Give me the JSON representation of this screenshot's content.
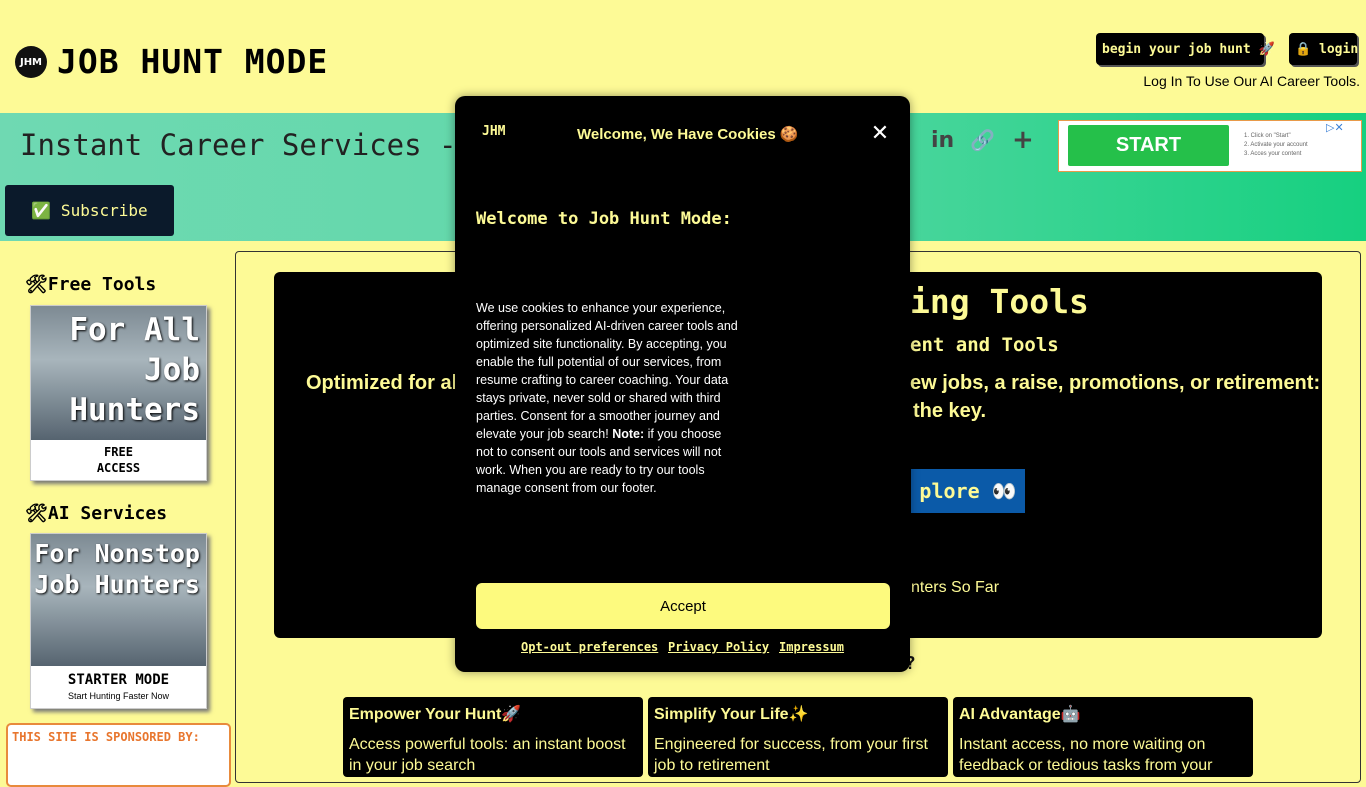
{
  "header": {
    "logo_badge": "JHM",
    "brand_title": "JOB HUNT MODE",
    "begin_hunt_label": "begin your job hunt 🚀",
    "login_label": "🔒 login",
    "login_note": "Log In To Use Our AI Career Tools."
  },
  "banner": {
    "title": "Instant Career Services -",
    "social_icons": [
      "pinterest-icon",
      "linkedin-icon",
      "link-icon",
      "plus-icon"
    ],
    "social_glyphs": [
      "in",
      "🔗",
      "+"
    ],
    "subscribe_label": "✅ Subscribe",
    "ad": {
      "start_label": "START",
      "steps": [
        "1. Click on \"Start\"",
        "2. Activate your account",
        "3. Acces your content"
      ],
      "corner": "▷✕"
    }
  },
  "sidebar": {
    "free_tools_heading": "🛠Free Tools",
    "ai_services_heading": "🛠AI Services",
    "cards": [
      {
        "image_text": "For All Job Hunters",
        "label_line1": "FREE",
        "label_line2": "ACCESS"
      },
      {
        "image_text": "For Nonstop Job Hunters",
        "label_line1": "STARTER MODE",
        "label_line2": "Start Hunting Faster Now"
      }
    ],
    "sponsor_text": "THIS SITE IS SPONSORED BY:"
  },
  "hero": {
    "title_fragment": "ing Tools",
    "subtitle_fragment": "ent and Tools",
    "left_fragment": "Optimized for all",
    "right_line1": "ew jobs, a raise, promotions, or retirement:",
    "right_line2": "the key.",
    "explore_label": "plore 👀",
    "hunters_fragment": "nters So Far"
  },
  "section_question_fragment": "?",
  "features": [
    {
      "title": "Empower Your Hunt🚀",
      "body": "Access powerful tools: an instant boost in your job search"
    },
    {
      "title": "Simplify Your Life✨",
      "body": "Engineered for success, from your first job to retirement"
    },
    {
      "title": "AI Advantage🤖",
      "body": "Instant access, no more waiting on feedback or tedious tasks from your"
    }
  ],
  "modal": {
    "logo": "JHM",
    "title": "Welcome, We Have Cookies 🍪",
    "close": "✕",
    "heading": "Welcome to Job Hunt Mode:",
    "body_main": "We use cookies to enhance your experience, offering personalized AI-driven career tools and optimized site functionality. By accepting, you enable the full potential of our services, from resume crafting to career coaching. Your data stays private, never sold or shared with third parties. Consent for a smoother journey and elevate your job search! ",
    "body_note_label": "Note:",
    "body_note": " if you choose not to consent our tools and services will not work. When you are ready to try our tools manage consent from our footer.",
    "accept_label": "Accept",
    "links": [
      "Opt-out preferences",
      "Privacy Policy",
      "Impressum"
    ]
  },
  "colors": {
    "page_bg": "#fdfa96",
    "accent_yellow": "#fdfa7e",
    "banner_green": "#16d080",
    "dark": "#000000",
    "explore_blue": "#0b5aa8"
  }
}
